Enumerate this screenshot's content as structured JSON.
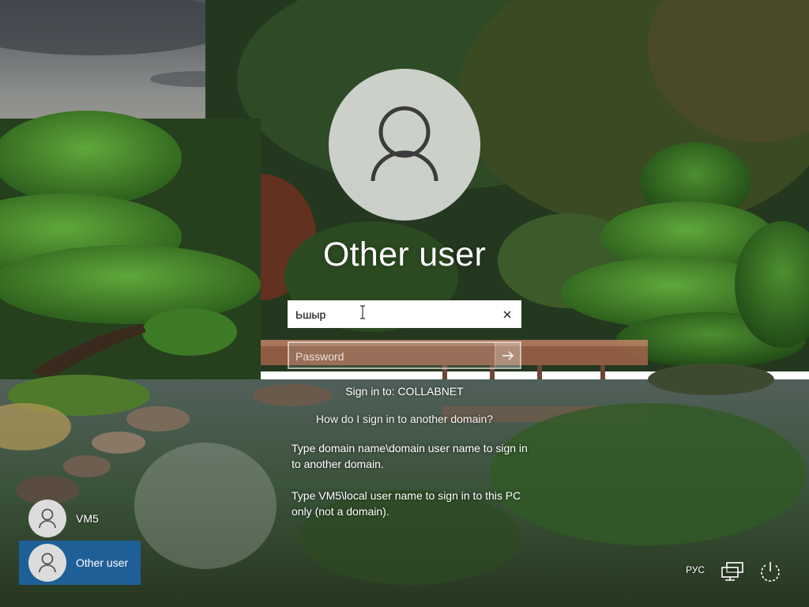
{
  "login": {
    "title": "Other user",
    "username_value": "Ьшыр",
    "password_placeholder": "Password",
    "signin_to": "Sign in to: COLLABNET",
    "help_link": "How do I sign in to another domain?",
    "help_line_1": "Type domain name\\domain user name to sign in to another domain.",
    "help_line_2": "Type VM5\\local user name to sign in to this PC only (not a domain)."
  },
  "user_tiles": [
    {
      "name": "VM5",
      "selected": false
    },
    {
      "name": "Other user",
      "selected": true
    }
  ],
  "tray": {
    "language": "РУС",
    "network_icon": "network-icon",
    "power_icon": "power-icon"
  },
  "colors": {
    "selected_tile": "#1f5f97",
    "avatar_bg": "#d7dad6"
  }
}
